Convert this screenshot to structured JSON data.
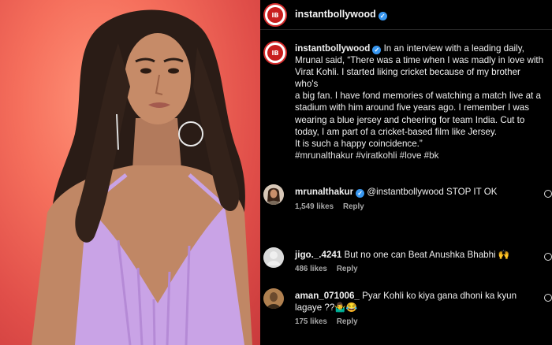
{
  "post": {
    "username": "instantbollywood",
    "verified": true,
    "avatar_logo_text": "IB",
    "caption_lines": [
      "In an interview with a leading daily,",
      "Mrunal said, “There was a time when I was madly in love with",
      "Virat Kohli. I started liking cricket because of my brother who's",
      "a big fan. I have fond memories of watching a match live at a",
      "stadium with him around five years ago. I remember I was",
      "wearing a blue jersey and cheering for team India. Cut to",
      "today, I am part of a cricket-based film like Jersey.",
      "It is such a happy coincidence.”"
    ],
    "hashtags": "#mrunalthakur #viratkohli #love #bk"
  },
  "comments": [
    {
      "username": "mrunalthakur",
      "verified": true,
      "text": "@instantbollywood STOP IT OK",
      "likes": "1,549 likes",
      "reply": "Reply",
      "avatar": "profile-photo"
    },
    {
      "username": "jigo._.4241",
      "verified": false,
      "text": "But no one can Beat Anushka Bhabhi 🙌",
      "likes": "486 likes",
      "reply": "Reply",
      "avatar": "default-avatar"
    },
    {
      "username": "aman_071006_",
      "verified": false,
      "text_line1": "Pyar Kohli ko kiya gana dhoni ka kyun",
      "text_line2": "lagaye ??🤷‍♂️😂",
      "likes": "175 likes",
      "reply": "Reply",
      "avatar": "profile-photo"
    }
  ],
  "colors": {
    "background": "#000000",
    "photo_backdrop": "#f56f5c",
    "dress": "#c9a3e6",
    "verified_badge": "#3897f0",
    "secondary_text": "#a8a8a8"
  }
}
